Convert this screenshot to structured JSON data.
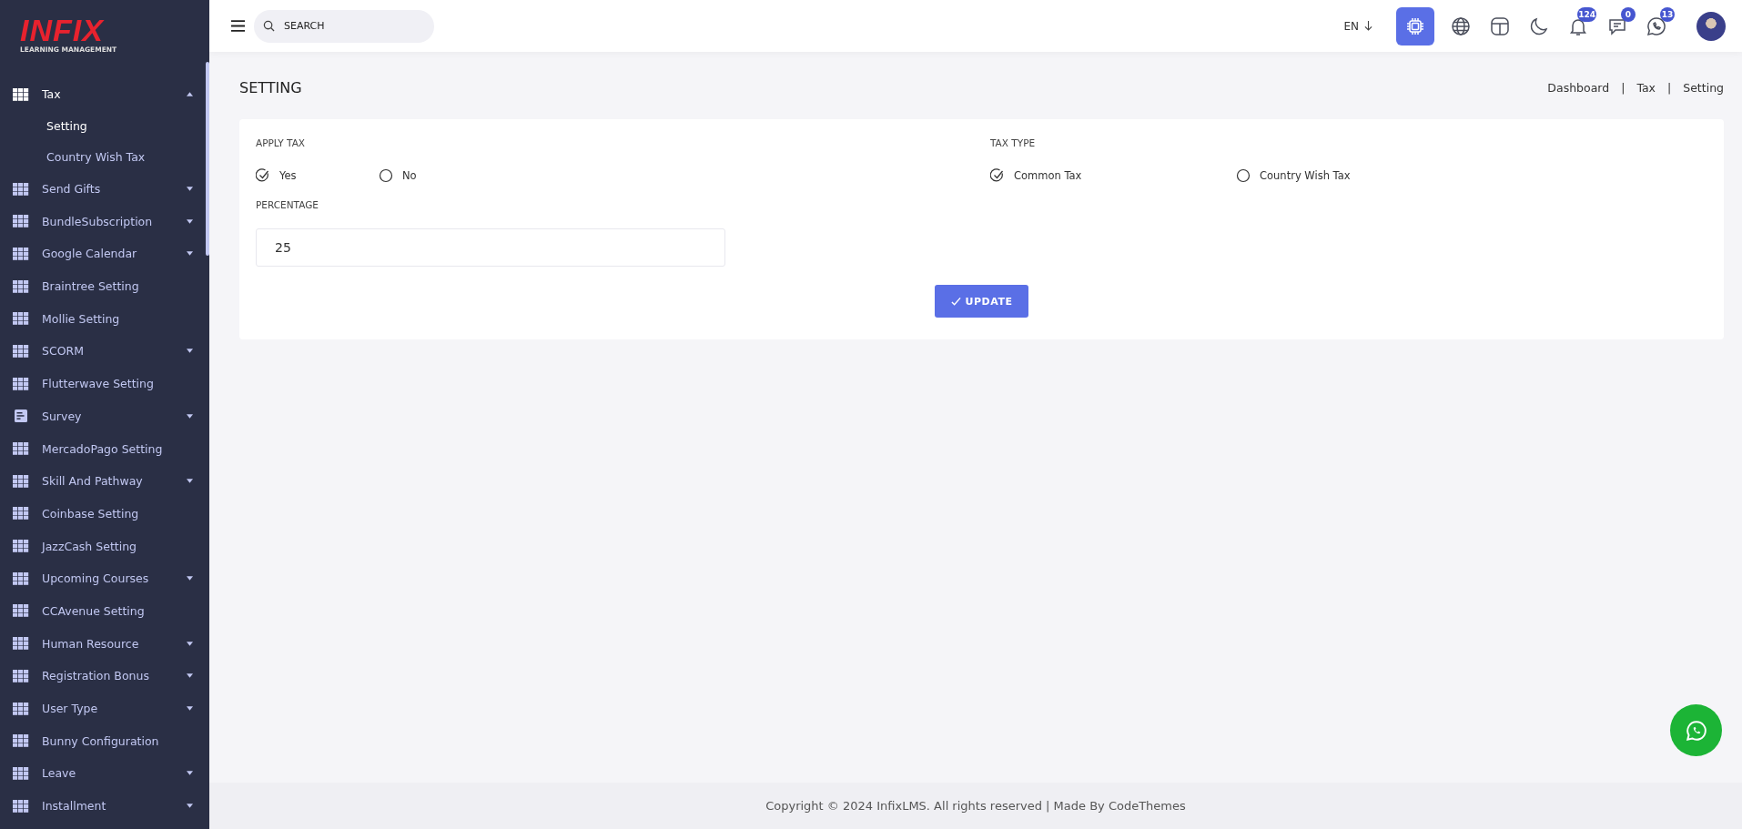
{
  "logo": {
    "brand": "INFIX",
    "tagline": "LEARNING MANAGEMENT"
  },
  "sidebar": {
    "items": [
      {
        "label": "Tax",
        "kind": "menu",
        "expanded": true,
        "active": true,
        "children": [
          {
            "label": "Setting",
            "selected": true
          },
          {
            "label": "Country Wish Tax",
            "selected": false
          }
        ]
      },
      {
        "label": "Send Gifts",
        "kind": "menu",
        "expanded": false,
        "active": false
      },
      {
        "label": "BundleSubscription",
        "kind": "menu",
        "expanded": false,
        "active": false
      },
      {
        "label": "Google Calendar",
        "kind": "menu",
        "expanded": false,
        "active": false
      },
      {
        "label": "Braintree Setting",
        "kind": "link",
        "active": false
      },
      {
        "label": "Mollie Setting",
        "kind": "link",
        "active": false
      },
      {
        "label": "SCORM",
        "kind": "menu",
        "expanded": false,
        "active": false
      },
      {
        "label": "Flutterwave Setting",
        "kind": "link",
        "active": false
      },
      {
        "label": "Survey",
        "kind": "formmenu",
        "expanded": false,
        "active": false
      },
      {
        "label": "MercadoPago Setting",
        "kind": "link",
        "active": false
      },
      {
        "label": "Skill And Pathway",
        "kind": "menu",
        "expanded": false,
        "active": false
      },
      {
        "label": "Coinbase Setting",
        "kind": "link",
        "active": false
      },
      {
        "label": "JazzCash Setting",
        "kind": "link",
        "active": false
      },
      {
        "label": "Upcoming Courses",
        "kind": "menu",
        "expanded": false,
        "active": false
      },
      {
        "label": "CCAvenue Setting",
        "kind": "link",
        "active": false
      },
      {
        "label": "Human Resource",
        "kind": "menu",
        "expanded": false,
        "active": false
      },
      {
        "label": "Registration Bonus",
        "kind": "menu",
        "expanded": false,
        "active": false
      },
      {
        "label": "User Type",
        "kind": "menu",
        "expanded": false,
        "active": false
      },
      {
        "label": "Bunny Configuration",
        "kind": "link",
        "active": false
      },
      {
        "label": "Leave",
        "kind": "menu",
        "expanded": false,
        "active": false
      },
      {
        "label": "Installment",
        "kind": "menu",
        "expanded": false,
        "active": false
      }
    ]
  },
  "header": {
    "search": {
      "placeholder": "SEARCH"
    },
    "language": "EN",
    "icons": [
      {
        "kind": "ai",
        "selected": true
      },
      {
        "kind": "globe",
        "selected": false
      },
      {
        "kind": "layout",
        "selected": false
      },
      {
        "kind": "moon",
        "selected": false
      },
      {
        "kind": "bell",
        "selected": false,
        "badge": "124"
      },
      {
        "kind": "chat",
        "selected": false,
        "badge": "0"
      },
      {
        "kind": "phone",
        "selected": false,
        "badge": "13"
      }
    ]
  },
  "page": {
    "title": "SETTING",
    "breadcrumb": [
      {
        "label": "Dashboard"
      },
      {
        "label": "Tax"
      },
      {
        "label": "Setting"
      }
    ],
    "separator": "|"
  },
  "form": {
    "groups": [
      {
        "label": "APPLY TAX",
        "options": [
          {
            "label": "Yes",
            "selected": true
          },
          {
            "label": "No",
            "selected": false
          }
        ]
      },
      {
        "label": "TAX TYPE",
        "options": [
          {
            "label": "Common Tax",
            "selected": true
          },
          {
            "label": "Country Wish Tax",
            "selected": false
          }
        ]
      }
    ],
    "percentage": {
      "label": "PERCENTAGE",
      "value": "25"
    },
    "submit": "UPDATE"
  },
  "footer": {
    "text": "Copyright © 2024 InfixLMS. All rights reserved | Made By CodeThemes"
  }
}
